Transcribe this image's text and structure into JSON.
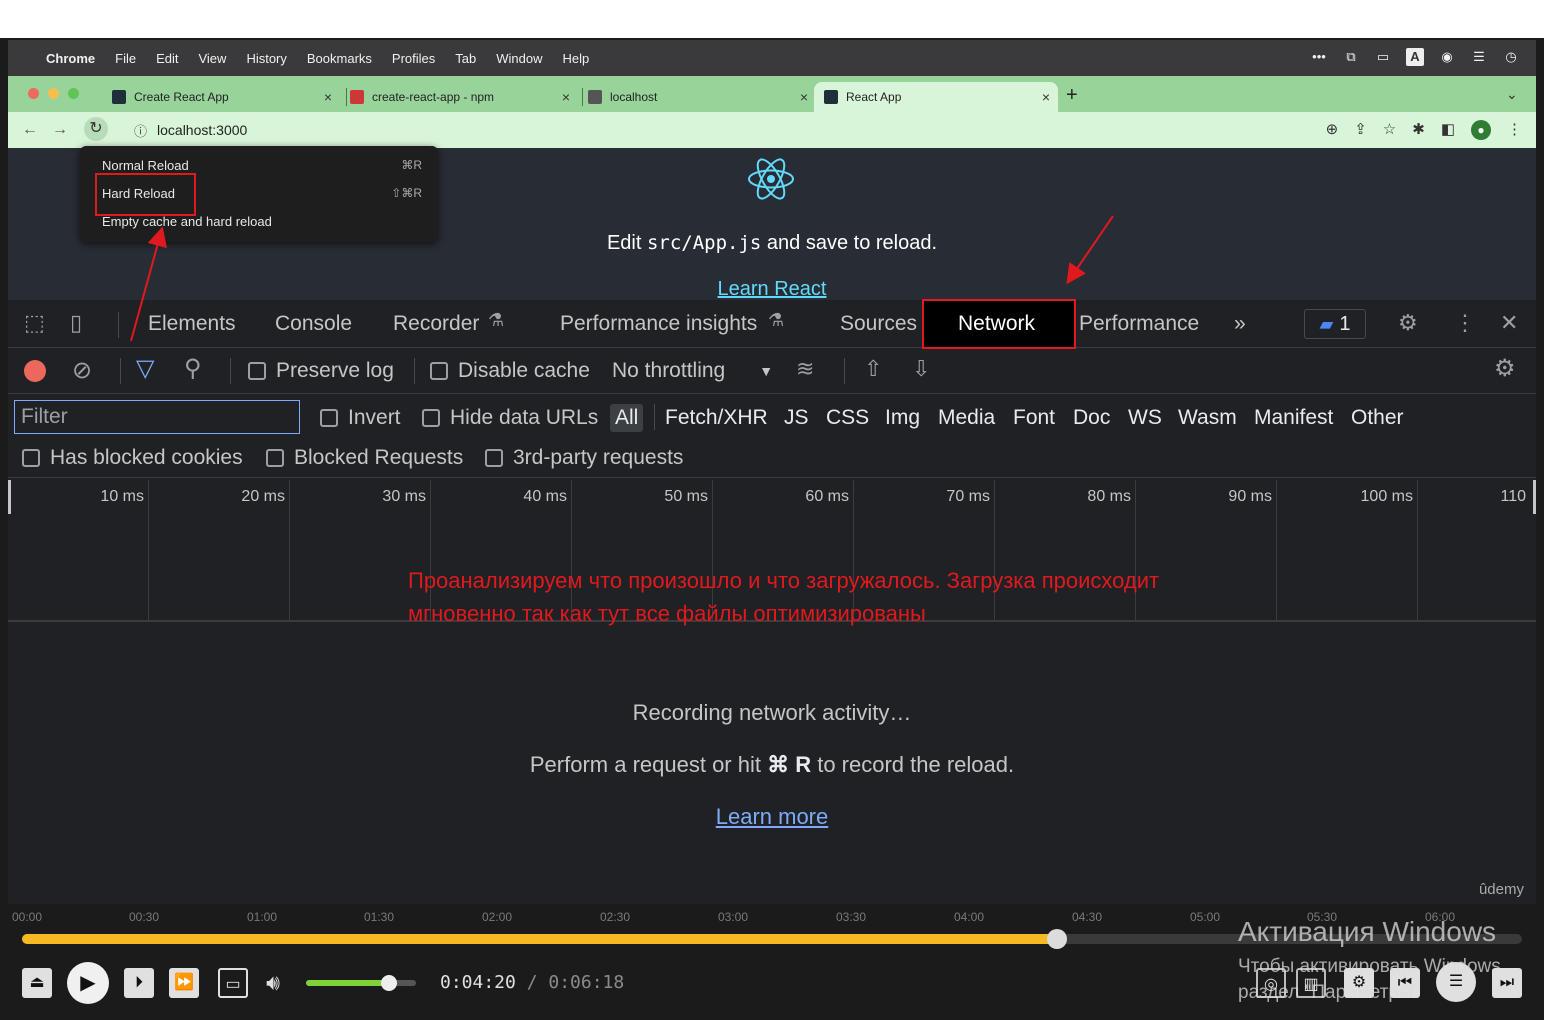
{
  "menubar": {
    "app": "Chrome",
    "items": [
      "File",
      "Edit",
      "View",
      "History",
      "Bookmarks",
      "Profiles",
      "Tab",
      "Window",
      "Help"
    ]
  },
  "tabs": [
    {
      "title": "Create React App"
    },
    {
      "title": "create-react-app - npm"
    },
    {
      "title": "localhost"
    },
    {
      "title": "React App"
    }
  ],
  "address": {
    "url": "localhost:3000"
  },
  "page": {
    "edit_before": "Edit ",
    "edit_code": "src/App.js",
    "edit_after": " and save to reload.",
    "learn_react": "Learn React"
  },
  "reload_menu": {
    "items": [
      {
        "label": "Normal Reload",
        "shortcut": "⌘R"
      },
      {
        "label": "Hard Reload",
        "shortcut": "⇧⌘R"
      },
      {
        "label": "Empty cache and hard reload",
        "shortcut": ""
      }
    ]
  },
  "devtools": {
    "tabs": {
      "elements": "Elements",
      "console": "Console",
      "recorder": "Recorder",
      "perf_insights": "Performance insights",
      "sources": "Sources",
      "network": "Network",
      "performance": "Performance",
      "more": "»",
      "issues_count": "1"
    },
    "toolbar": {
      "preserve_log": "Preserve log",
      "disable_cache": "Disable cache",
      "throttling": "No throttling"
    },
    "filter": {
      "placeholder": "Filter",
      "invert": "Invert",
      "hide_data_urls": "Hide data URLs",
      "types": [
        "All",
        "Fetch/XHR",
        "JS",
        "CSS",
        "Img",
        "Media",
        "Font",
        "Doc",
        "WS",
        "Wasm",
        "Manifest",
        "Other"
      ]
    },
    "blocked": {
      "has_blocked_cookies": "Has blocked cookies",
      "blocked_requests": "Blocked Requests",
      "third_party": "3rd-party requests"
    },
    "timeline_labels": [
      "10 ms",
      "20 ms",
      "30 ms",
      "40 ms",
      "50 ms",
      "60 ms",
      "70 ms",
      "80 ms",
      "90 ms",
      "100 ms",
      "110"
    ],
    "empty": {
      "title": "Recording network activity…",
      "hint_before": "Perform a request or hit ",
      "hint_key": "⌘ R",
      "hint_after": " to record the reload.",
      "learn_more": "Learn more"
    }
  },
  "annotation": {
    "line1": "Проанализируем что произошло и что загружалось. Загрузка происходит",
    "line2": "мгновенно так как тут все файлы оптимизированы"
  },
  "watermark": "ûdemy",
  "player": {
    "time_ticks": [
      "00:00",
      "00:30",
      "01:00",
      "01:30",
      "02:00",
      "02:30",
      "03:00",
      "03:30",
      "04:00",
      "04:30",
      "05:00",
      "05:30",
      "06:00"
    ],
    "progress_fraction": 0.69,
    "volume_fraction": 0.75,
    "current_time": "0:04:20",
    "separator": " / ",
    "total_time": "0:06:18"
  },
  "windows_activation": {
    "title": "Активация Windows",
    "line1": "Чтобы активировать Windows",
    "line2": "раздел \"Параметры\""
  },
  "colors": {
    "tab_strip": "#98d49a",
    "annotation_red": "#e0191e",
    "react_blue": "#61dafb",
    "seek_yellow": "#f6b924"
  }
}
